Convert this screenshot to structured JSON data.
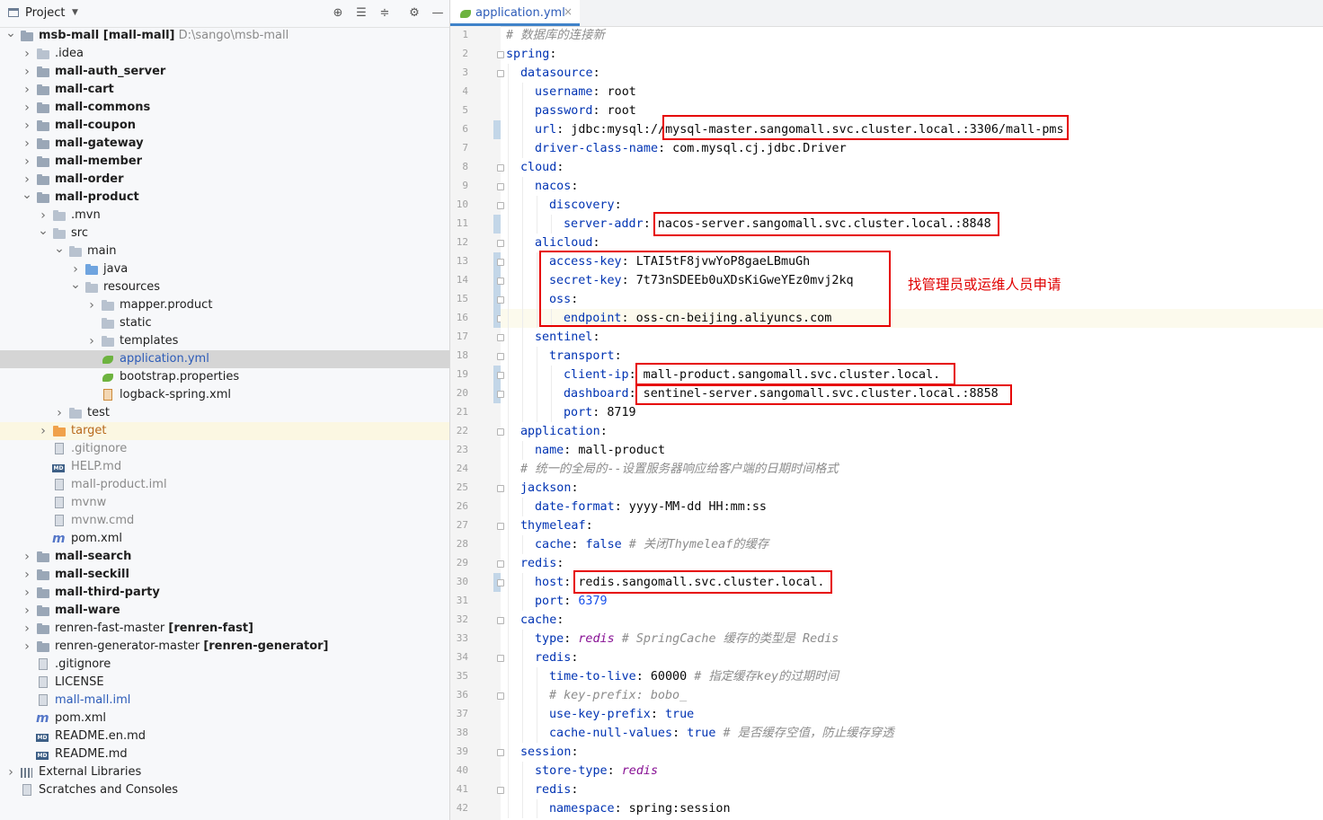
{
  "project_panel": {
    "title": "Project",
    "tree": [
      {
        "indent": 0,
        "chev": "open",
        "icon": "module-folder-icon",
        "parts": [
          {
            "t": "msb-mall ",
            "c": "bold"
          },
          {
            "t": "[mall-mall]",
            "c": "bold"
          },
          {
            "t": "  D:\\sango\\msb-mall",
            "c": "gray"
          }
        ]
      },
      {
        "indent": 1,
        "chev": "closed",
        "icon": "folder-icon",
        "parts": [
          {
            "t": ".idea",
            "c": ""
          }
        ]
      },
      {
        "indent": 1,
        "chev": "closed",
        "icon": "module-folder-icon",
        "parts": [
          {
            "t": "mall-auth_server",
            "c": "bold"
          }
        ]
      },
      {
        "indent": 1,
        "chev": "closed",
        "icon": "module-folder-icon",
        "parts": [
          {
            "t": "mall-cart",
            "c": "bold"
          }
        ]
      },
      {
        "indent": 1,
        "chev": "closed",
        "icon": "module-folder-icon",
        "parts": [
          {
            "t": "mall-commons",
            "c": "bold"
          }
        ]
      },
      {
        "indent": 1,
        "chev": "closed",
        "icon": "module-folder-icon",
        "parts": [
          {
            "t": "mall-coupon",
            "c": "bold"
          }
        ]
      },
      {
        "indent": 1,
        "chev": "closed",
        "icon": "module-folder-icon",
        "parts": [
          {
            "t": "mall-gateway",
            "c": "bold"
          }
        ]
      },
      {
        "indent": 1,
        "chev": "closed",
        "icon": "module-folder-icon",
        "parts": [
          {
            "t": "mall-member",
            "c": "bold"
          }
        ]
      },
      {
        "indent": 1,
        "chev": "closed",
        "icon": "module-folder-icon",
        "parts": [
          {
            "t": "mall-order",
            "c": "bold"
          }
        ]
      },
      {
        "indent": 1,
        "chev": "open",
        "icon": "module-folder-icon",
        "parts": [
          {
            "t": "mall-product",
            "c": "bold"
          }
        ]
      },
      {
        "indent": 2,
        "chev": "closed",
        "icon": "folder-icon",
        "parts": [
          {
            "t": ".mvn",
            "c": ""
          }
        ]
      },
      {
        "indent": 2,
        "chev": "open",
        "icon": "folder-icon",
        "parts": [
          {
            "t": "src",
            "c": ""
          }
        ]
      },
      {
        "indent": 3,
        "chev": "open",
        "icon": "folder-icon",
        "parts": [
          {
            "t": "main",
            "c": ""
          }
        ]
      },
      {
        "indent": 4,
        "chev": "closed",
        "icon": "source-folder-icon",
        "parts": [
          {
            "t": "java",
            "c": ""
          }
        ]
      },
      {
        "indent": 4,
        "chev": "open",
        "icon": "resources-folder-icon",
        "parts": [
          {
            "t": "resources",
            "c": ""
          }
        ]
      },
      {
        "indent": 5,
        "chev": "closed",
        "icon": "folder-icon",
        "parts": [
          {
            "t": "mapper.product",
            "c": ""
          }
        ]
      },
      {
        "indent": 5,
        "chev": "none",
        "icon": "folder-icon",
        "parts": [
          {
            "t": "static",
            "c": ""
          }
        ]
      },
      {
        "indent": 5,
        "chev": "closed",
        "icon": "folder-icon",
        "parts": [
          {
            "t": "templates",
            "c": ""
          }
        ]
      },
      {
        "indent": 5,
        "chev": "none",
        "icon": "yaml-file-icon",
        "parts": [
          {
            "t": "application.yml",
            "c": "blue"
          }
        ],
        "selected": true
      },
      {
        "indent": 5,
        "chev": "none",
        "icon": "properties-file-icon",
        "parts": [
          {
            "t": "bootstrap.properties",
            "c": ""
          }
        ]
      },
      {
        "indent": 5,
        "chev": "none",
        "icon": "xml-file-icon",
        "parts": [
          {
            "t": "logback-spring.xml",
            "c": ""
          }
        ]
      },
      {
        "indent": 3,
        "chev": "closed",
        "icon": "folder-icon",
        "parts": [
          {
            "t": "test",
            "c": ""
          }
        ]
      },
      {
        "indent": 2,
        "chev": "closed",
        "icon": "excluded-folder-icon",
        "parts": [
          {
            "t": "target",
            "c": "orange"
          }
        ],
        "excluded": true
      },
      {
        "indent": 2,
        "chev": "none",
        "icon": "gitignore-file-icon",
        "parts": [
          {
            "t": ".gitignore",
            "c": "gray"
          }
        ]
      },
      {
        "indent": 2,
        "chev": "none",
        "icon": "markdown-file-icon",
        "parts": [
          {
            "t": "HELP.md",
            "c": "gray"
          }
        ]
      },
      {
        "indent": 2,
        "chev": "none",
        "icon": "iml-file-icon",
        "parts": [
          {
            "t": "mall-product.iml",
            "c": "gray"
          }
        ]
      },
      {
        "indent": 2,
        "chev": "none",
        "icon": "script-file-icon",
        "parts": [
          {
            "t": "mvnw",
            "c": "gray"
          }
        ]
      },
      {
        "indent": 2,
        "chev": "none",
        "icon": "text-file-icon",
        "parts": [
          {
            "t": "mvnw.cmd",
            "c": "gray"
          }
        ]
      },
      {
        "indent": 2,
        "chev": "none",
        "icon": "maven-file-icon",
        "parts": [
          {
            "t": "pom.xml",
            "c": ""
          }
        ]
      },
      {
        "indent": 1,
        "chev": "closed",
        "icon": "module-folder-icon",
        "parts": [
          {
            "t": "mall-search",
            "c": "bold"
          }
        ]
      },
      {
        "indent": 1,
        "chev": "closed",
        "icon": "module-folder-icon",
        "parts": [
          {
            "t": "mall-seckill",
            "c": "bold"
          }
        ]
      },
      {
        "indent": 1,
        "chev": "closed",
        "icon": "module-folder-icon",
        "parts": [
          {
            "t": "mall-third-party",
            "c": "bold"
          }
        ]
      },
      {
        "indent": 1,
        "chev": "closed",
        "icon": "module-folder-icon",
        "parts": [
          {
            "t": "mall-ware",
            "c": "bold"
          }
        ]
      },
      {
        "indent": 1,
        "chev": "closed",
        "icon": "module-folder-icon",
        "parts": [
          {
            "t": "renren-fast-master ",
            "c": ""
          },
          {
            "t": "[renren-fast]",
            "c": "bold"
          }
        ]
      },
      {
        "indent": 1,
        "chev": "closed",
        "icon": "module-folder-icon",
        "parts": [
          {
            "t": "renren-generator-master ",
            "c": ""
          },
          {
            "t": "[renren-generator]",
            "c": "bold"
          }
        ]
      },
      {
        "indent": 1,
        "chev": "none",
        "icon": "gitignore-file-icon",
        "parts": [
          {
            "t": ".gitignore",
            "c": ""
          }
        ]
      },
      {
        "indent": 1,
        "chev": "none",
        "icon": "text-file-icon",
        "parts": [
          {
            "t": "LICENSE",
            "c": ""
          }
        ]
      },
      {
        "indent": 1,
        "chev": "none",
        "icon": "iml-file-icon",
        "parts": [
          {
            "t": "mall-mall.iml",
            "c": "blue"
          }
        ]
      },
      {
        "indent": 1,
        "chev": "none",
        "icon": "maven-file-icon",
        "parts": [
          {
            "t": "pom.xml",
            "c": ""
          }
        ]
      },
      {
        "indent": 1,
        "chev": "none",
        "icon": "markdown-file-icon",
        "parts": [
          {
            "t": "README.en.md",
            "c": ""
          }
        ]
      },
      {
        "indent": 1,
        "chev": "none",
        "icon": "markdown-file-icon",
        "parts": [
          {
            "t": "README.md",
            "c": ""
          }
        ]
      },
      {
        "indent": 0,
        "chev": "closed",
        "icon": "libraries-icon",
        "parts": [
          {
            "t": "External Libraries",
            "c": ""
          }
        ]
      },
      {
        "indent": 0,
        "chev": "none",
        "icon": "scratches-icon",
        "parts": [
          {
            "t": "Scratches and Consoles",
            "c": ""
          }
        ]
      }
    ]
  },
  "editor": {
    "tab_label": "application.yml",
    "current_line": 16,
    "modified_lines": [
      6,
      11,
      13,
      14,
      15,
      16,
      19,
      20,
      30
    ],
    "lines": [
      {
        "n": 1,
        "i": 0,
        "tokens": [
          {
            "t": "# 数据库的连接新",
            "c": "cm"
          }
        ]
      },
      {
        "n": 2,
        "i": 0,
        "tokens": [
          {
            "t": "spring",
            "c": "k"
          },
          {
            "t": ":",
            "c": "v"
          }
        ]
      },
      {
        "n": 3,
        "i": 1,
        "tokens": [
          {
            "t": "datasource",
            "c": "k"
          },
          {
            "t": ":",
            "c": "v"
          }
        ]
      },
      {
        "n": 4,
        "i": 2,
        "tokens": [
          {
            "t": "username",
            "c": "k"
          },
          {
            "t": ": root",
            "c": "v"
          }
        ]
      },
      {
        "n": 5,
        "i": 2,
        "tokens": [
          {
            "t": "password",
            "c": "k"
          },
          {
            "t": ": root",
            "c": "v"
          }
        ]
      },
      {
        "n": 6,
        "i": 2,
        "tokens": [
          {
            "t": "url",
            "c": "k"
          },
          {
            "t": ": jdbc:mysql://mysql-master.sangomall.svc.cluster.local.:3306/mall-pms",
            "c": "v"
          }
        ]
      },
      {
        "n": 7,
        "i": 2,
        "tokens": [
          {
            "t": "driver-class-name",
            "c": "k"
          },
          {
            "t": ": com.mysql.cj.jdbc.Driver",
            "c": "v"
          }
        ]
      },
      {
        "n": 8,
        "i": 1,
        "tokens": [
          {
            "t": "cloud",
            "c": "k"
          },
          {
            "t": ":",
            "c": "v"
          }
        ]
      },
      {
        "n": 9,
        "i": 2,
        "tokens": [
          {
            "t": "nacos",
            "c": "k"
          },
          {
            "t": ":",
            "c": "v"
          }
        ]
      },
      {
        "n": 10,
        "i": 3,
        "tokens": [
          {
            "t": "discovery",
            "c": "k"
          },
          {
            "t": ":",
            "c": "v"
          }
        ]
      },
      {
        "n": 11,
        "i": 4,
        "tokens": [
          {
            "t": "server-addr",
            "c": "k"
          },
          {
            "t": ": nacos-server.sangomall.svc.cluster.local.:8848",
            "c": "v"
          }
        ]
      },
      {
        "n": 12,
        "i": 2,
        "tokens": [
          {
            "t": "alicloud",
            "c": "k"
          },
          {
            "t": ":",
            "c": "v"
          }
        ]
      },
      {
        "n": 13,
        "i": 3,
        "tokens": [
          {
            "t": "access-key",
            "c": "k"
          },
          {
            "t": ": LTAI5tF8jvwYoP8gaeLBmuGh",
            "c": "v"
          }
        ]
      },
      {
        "n": 14,
        "i": 3,
        "tokens": [
          {
            "t": "secret-key",
            "c": "k"
          },
          {
            "t": ": 7t73nSDEEb0uXDsKiGweYEz0mvj2kq",
            "c": "v"
          }
        ]
      },
      {
        "n": 15,
        "i": 3,
        "tokens": [
          {
            "t": "oss",
            "c": "k"
          },
          {
            "t": ":",
            "c": "v"
          }
        ]
      },
      {
        "n": 16,
        "i": 4,
        "tokens": [
          {
            "t": "endpoint",
            "c": "k"
          },
          {
            "t": ": oss-cn-beijing.aliyuncs.com",
            "c": "v"
          }
        ]
      },
      {
        "n": 17,
        "i": 2,
        "tokens": [
          {
            "t": "sentinel",
            "c": "k"
          },
          {
            "t": ":",
            "c": "v"
          }
        ]
      },
      {
        "n": 18,
        "i": 3,
        "tokens": [
          {
            "t": "transport",
            "c": "k"
          },
          {
            "t": ":",
            "c": "v"
          }
        ]
      },
      {
        "n": 19,
        "i": 4,
        "tokens": [
          {
            "t": "client-ip",
            "c": "k"
          },
          {
            "t": ": mall-product.sangomall.svc.cluster.local.",
            "c": "v"
          }
        ]
      },
      {
        "n": 20,
        "i": 4,
        "tokens": [
          {
            "t": "dashboard",
            "c": "k"
          },
          {
            "t": ": sentinel-server.sangomall.svc.cluster.local.:8858",
            "c": "v"
          }
        ]
      },
      {
        "n": 21,
        "i": 4,
        "tokens": [
          {
            "t": "port",
            "c": "k"
          },
          {
            "t": ": 8719",
            "c": "v"
          }
        ]
      },
      {
        "n": 22,
        "i": 1,
        "tokens": [
          {
            "t": "application",
            "c": "k"
          },
          {
            "t": ":",
            "c": "v"
          }
        ]
      },
      {
        "n": 23,
        "i": 2,
        "tokens": [
          {
            "t": "name",
            "c": "k"
          },
          {
            "t": ": mall-product",
            "c": "v"
          }
        ]
      },
      {
        "n": 24,
        "i": 1,
        "tokens": [
          {
            "t": "# 统一的全局的--设置服务器响应给客户端的日期时间格式",
            "c": "cm"
          }
        ]
      },
      {
        "n": 25,
        "i": 1,
        "tokens": [
          {
            "t": "jackson",
            "c": "k"
          },
          {
            "t": ":",
            "c": "v"
          }
        ]
      },
      {
        "n": 26,
        "i": 2,
        "tokens": [
          {
            "t": "date-format",
            "c": "k"
          },
          {
            "t": ": yyyy-MM-dd HH:mm:ss",
            "c": "v"
          }
        ]
      },
      {
        "n": 27,
        "i": 1,
        "tokens": [
          {
            "t": "thymeleaf",
            "c": "k"
          },
          {
            "t": ":",
            "c": "v"
          }
        ]
      },
      {
        "n": 28,
        "i": 2,
        "tokens": [
          {
            "t": "cache",
            "c": "k"
          },
          {
            "t": ": ",
            "c": "v"
          },
          {
            "t": "false",
            "c": "kw"
          },
          {
            "t": " # 关闭Thymeleaf的缓存",
            "c": "cm"
          }
        ]
      },
      {
        "n": 29,
        "i": 1,
        "tokens": [
          {
            "t": "redis",
            "c": "k"
          },
          {
            "t": ":",
            "c": "v"
          }
        ]
      },
      {
        "n": 30,
        "i": 2,
        "tokens": [
          {
            "t": "host",
            "c": "k"
          },
          {
            "t": ": redis.sangomall.svc.cluster.local.",
            "c": "v"
          }
        ]
      },
      {
        "n": 31,
        "i": 2,
        "tokens": [
          {
            "t": "port",
            "c": "k"
          },
          {
            "t": ": ",
            "c": "v"
          },
          {
            "t": "6379",
            "c": "num"
          }
        ]
      },
      {
        "n": 32,
        "i": 1,
        "tokens": [
          {
            "t": "cache",
            "c": "k"
          },
          {
            "t": ":",
            "c": "v"
          }
        ]
      },
      {
        "n": 33,
        "i": 2,
        "tokens": [
          {
            "t": "type",
            "c": "k"
          },
          {
            "t": ": ",
            "c": "v"
          },
          {
            "t": "redis",
            "c": "it"
          },
          {
            "t": " # SpringCache 缓存的类型是 Redis",
            "c": "cm"
          }
        ]
      },
      {
        "n": 34,
        "i": 2,
        "tokens": [
          {
            "t": "redis",
            "c": "k"
          },
          {
            "t": ":",
            "c": "v"
          }
        ]
      },
      {
        "n": 35,
        "i": 3,
        "tokens": [
          {
            "t": "time-to-live",
            "c": "k"
          },
          {
            "t": ": 60000",
            "c": "v"
          },
          {
            "t": " # 指定缓存key的过期时间",
            "c": "cm"
          }
        ]
      },
      {
        "n": 36,
        "i": 3,
        "tokens": [
          {
            "t": "# key-prefix: bobo_",
            "c": "cm"
          }
        ]
      },
      {
        "n": 37,
        "i": 3,
        "tokens": [
          {
            "t": "use-key-prefix",
            "c": "k"
          },
          {
            "t": ": ",
            "c": "v"
          },
          {
            "t": "true",
            "c": "kw"
          }
        ]
      },
      {
        "n": 38,
        "i": 3,
        "tokens": [
          {
            "t": "cache-null-values",
            "c": "k"
          },
          {
            "t": ": ",
            "c": "v"
          },
          {
            "t": "true",
            "c": "kw"
          },
          {
            "t": " # 是否缓存空值，防止缓存穿透",
            "c": "cm"
          }
        ]
      },
      {
        "n": 39,
        "i": 1,
        "tokens": [
          {
            "t": "session",
            "c": "k"
          },
          {
            "t": ":",
            "c": "v"
          }
        ]
      },
      {
        "n": 40,
        "i": 2,
        "tokens": [
          {
            "t": "store-type",
            "c": "k"
          },
          {
            "t": ": ",
            "c": "v"
          },
          {
            "t": "redis",
            "c": "it"
          }
        ]
      },
      {
        "n": 41,
        "i": 2,
        "tokens": [
          {
            "t": "redis",
            "c": "k"
          },
          {
            "t": ":",
            "c": "v"
          }
        ]
      },
      {
        "n": 42,
        "i": 3,
        "tokens": [
          {
            "t": "namespace",
            "c": "k"
          },
          {
            "t": ": spring:session",
            "c": "v"
          }
        ]
      }
    ],
    "annotation_text": "找管理员或运维人员申请"
  }
}
